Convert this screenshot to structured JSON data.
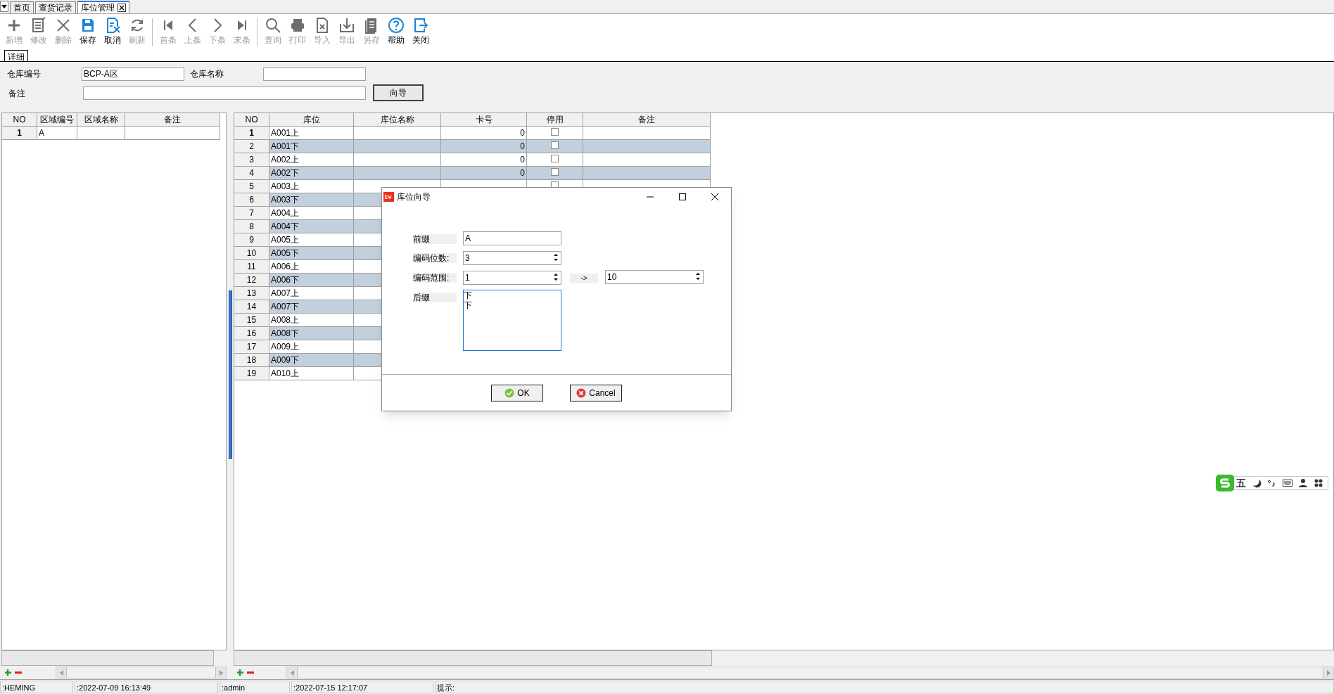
{
  "tabs": [
    {
      "label": "首页",
      "selected": false,
      "closable": false
    },
    {
      "label": "查货记录",
      "selected": false,
      "closable": false
    },
    {
      "label": "库位管理",
      "selected": true,
      "closable": true
    }
  ],
  "toolbar": [
    {
      "kind": "add",
      "label": "新增",
      "disabled": true
    },
    {
      "kind": "edit",
      "label": "修改",
      "disabled": true
    },
    {
      "kind": "delete",
      "label": "删除",
      "disabled": true
    },
    {
      "kind": "save",
      "label": "保存",
      "disabled": false
    },
    {
      "kind": "cancel",
      "label": "取消",
      "disabled": false
    },
    {
      "kind": "refresh",
      "label": "刷新",
      "disabled": true
    },
    {
      "kind": "separator"
    },
    {
      "kind": "first",
      "label": "首条",
      "disabled": true
    },
    {
      "kind": "prev",
      "label": "上条",
      "disabled": true
    },
    {
      "kind": "next",
      "label": "下条",
      "disabled": true
    },
    {
      "kind": "last",
      "label": "末条",
      "disabled": true
    },
    {
      "kind": "separator"
    },
    {
      "kind": "search",
      "label": "查询",
      "disabled": true
    },
    {
      "kind": "print",
      "label": "打印",
      "disabled": true
    },
    {
      "kind": "import",
      "label": "导入",
      "disabled": true
    },
    {
      "kind": "export",
      "label": "导出",
      "disabled": true
    },
    {
      "kind": "saveas",
      "label": "另存",
      "disabled": true
    },
    {
      "kind": "help",
      "label": "帮助",
      "disabled": false
    },
    {
      "kind": "close",
      "label": "关闭",
      "disabled": false
    }
  ],
  "detail_tab": {
    "label": "详细",
    "selected": true
  },
  "form": {
    "warehouse_code_label": "仓库编号",
    "warehouse_code": "BCP-A区",
    "warehouse_name_label": "仓库名称",
    "remark_label": "备注",
    "wizard_button": "向导"
  },
  "area_grid": {
    "columns": [
      "NO",
      "区域编号",
      "区域名称",
      "备注"
    ],
    "rows": [
      {
        "no": "1",
        "code": "A",
        "selected": true
      }
    ]
  },
  "location_grid": {
    "columns": [
      "NO",
      "库位",
      "库位名称",
      "卡号",
      "停用",
      "备注"
    ],
    "rows": [
      {
        "no": "1",
        "location": "A001上",
        "card": "0",
        "disabled": false,
        "selected": true
      },
      {
        "no": "2",
        "location": "A001下",
        "card": "0",
        "disabled": false,
        "selected": false
      },
      {
        "no": "3",
        "location": "A002上",
        "card": "0",
        "disabled": false,
        "selected": false
      },
      {
        "no": "4",
        "location": "A002下",
        "card": "0",
        "disabled": false,
        "selected": false
      },
      {
        "no": "5",
        "location": "A003上",
        "disabled": false,
        "selected": false
      },
      {
        "no": "6",
        "location": "A003下",
        "selected": false
      },
      {
        "no": "7",
        "location": "A004上",
        "selected": false
      },
      {
        "no": "8",
        "location": "A004下",
        "selected": false
      },
      {
        "no": "9",
        "location": "A005上",
        "selected": false
      },
      {
        "no": "10",
        "location": "A005下",
        "selected": false
      },
      {
        "no": "11",
        "location": "A006上",
        "selected": false
      },
      {
        "no": "12",
        "location": "A006下",
        "selected": false
      },
      {
        "no": "13",
        "location": "A007上",
        "selected": false
      },
      {
        "no": "14",
        "location": "A007下",
        "selected": false
      },
      {
        "no": "15",
        "location": "A008上",
        "selected": false
      },
      {
        "no": "16",
        "location": "A008下",
        "selected": false
      },
      {
        "no": "17",
        "location": "A009上",
        "selected": false
      },
      {
        "no": "18",
        "location": "A009下",
        "selected": false
      },
      {
        "no": "19",
        "location": "A010上",
        "selected": false
      }
    ]
  },
  "dialog": {
    "title": "库位向导",
    "prefix_label": "前缀",
    "prefix": "A",
    "digits_label": "编码位数:",
    "digits": "3",
    "range_label": "编码范围:",
    "range_from": "1",
    "range_arrow": "->",
    "range_to": "10",
    "suffix_label": "后缀",
    "suffix": [
      "下",
      "下"
    ],
    "ok": "OK",
    "cancel": "Cancel"
  },
  "ime_toolbar": {
    "mode": "五"
  },
  "status_bar": [
    ":HEMING",
    ":2022-07-09 16:13:49",
    ":admin",
    ":2022-07-15 12:17:07",
    "提示:"
  ]
}
